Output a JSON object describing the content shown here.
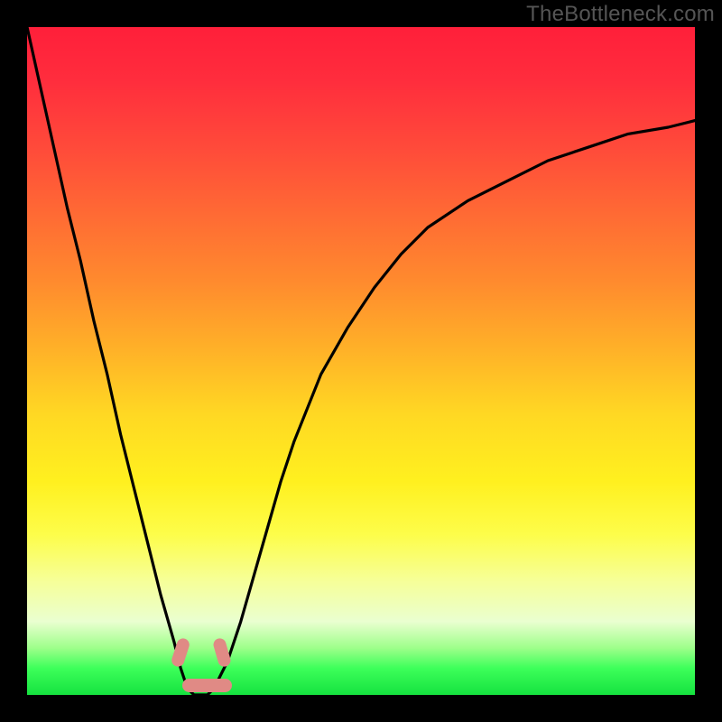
{
  "watermark": "TheBottleneck.com",
  "chart_data": {
    "type": "line",
    "title": "",
    "xlabel": "",
    "ylabel": "",
    "x": [
      0.0,
      0.02,
      0.04,
      0.06,
      0.08,
      0.1,
      0.12,
      0.14,
      0.16,
      0.18,
      0.2,
      0.22,
      0.23,
      0.24,
      0.25,
      0.26,
      0.27,
      0.28,
      0.3,
      0.32,
      0.34,
      0.36,
      0.38,
      0.4,
      0.44,
      0.48,
      0.52,
      0.56,
      0.6,
      0.66,
      0.72,
      0.78,
      0.84,
      0.9,
      0.96,
      1.0
    ],
    "values": [
      100,
      91,
      82,
      73,
      65,
      56,
      48,
      39,
      31,
      23,
      15,
      8,
      4,
      1,
      0,
      0,
      0,
      1,
      5,
      11,
      18,
      25,
      32,
      38,
      48,
      55,
      61,
      66,
      70,
      74,
      77,
      80,
      82,
      84,
      85,
      86
    ],
    "xlim": [
      0,
      1
    ],
    "ylim": [
      0,
      100
    ],
    "markers": [
      {
        "x_start": 0.224,
        "x_end": 0.236,
        "y": 5
      },
      {
        "x_start": 0.28,
        "x_end": 0.292,
        "y": 5
      },
      {
        "x_start": 0.238,
        "x_end": 0.3,
        "y": 0
      }
    ],
    "background": "vertical red-to-green gradient (value heatmap)",
    "frame": "black"
  }
}
